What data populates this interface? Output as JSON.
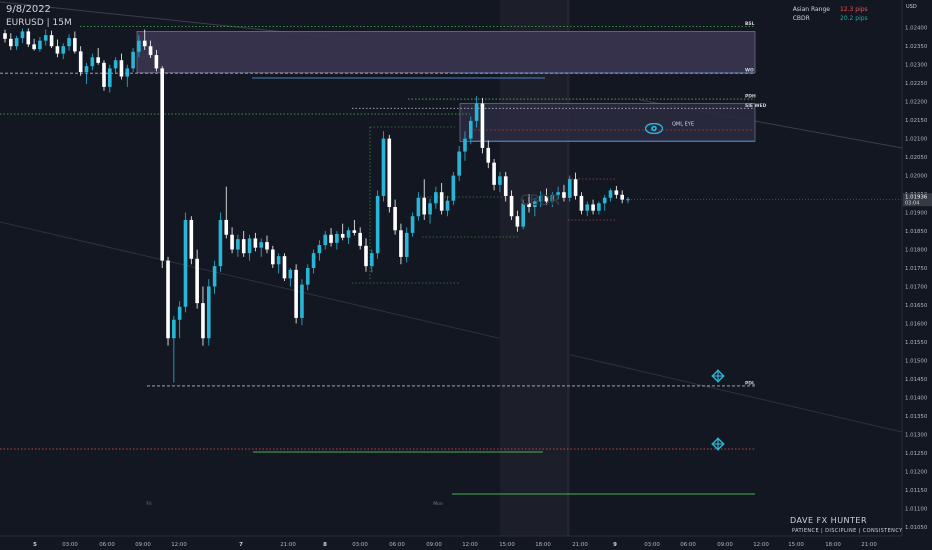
{
  "header": {
    "date": "9/8/2022",
    "symbol_timeframe": "EURUSD | 15M"
  },
  "session_stats": {
    "rows": [
      {
        "label": "Asian Range",
        "value": "12.3 pips",
        "color": "#ef5350"
      },
      {
        "label": "CBDR",
        "value": "20.2 pips",
        "color": "#26a69a"
      }
    ]
  },
  "branding": {
    "title": "DAVE FX HUNTER",
    "motto": "PATIENCE | DISCIPLINE | CONSISTENCY"
  },
  "chart_data": {
    "type": "candlestick",
    "symbol": "EURUSD",
    "timeframe": "15M",
    "currency_label": "USD",
    "y_ticks": [
      "1.02450",
      "1.02400",
      "1.02350",
      "1.02300",
      "1.02250",
      "1.02200",
      "1.02150",
      "1.02100",
      "1.02050",
      "1.02000",
      "1.01950",
      "1.01900",
      "1.01850",
      "1.01800",
      "1.01750",
      "1.01700",
      "1.01650",
      "1.01600",
      "1.01550",
      "1.01500",
      "1.01450",
      "1.01400",
      "1.01350",
      "1.01300",
      "1.01250",
      "1.01200",
      "1.01150",
      "1.01100",
      "1.01050"
    ],
    "ylim": [
      1.01025,
      1.02475
    ],
    "current_price": {
      "price": "1.01936",
      "countdown": "03:04"
    },
    "x_ticks": [
      "5",
      "03:00",
      "06:00",
      "09:00",
      "12:00",
      "7",
      "21:00",
      "8",
      "03:00",
      "06:00",
      "09:00",
      "12:00",
      "15:00",
      "18:00",
      "21:00",
      "9",
      "03:00",
      "06:00",
      "09:00",
      "12:00",
      "15:00",
      "18:00",
      "21:00"
    ],
    "session_labels": [
      "Fri",
      "Mon"
    ],
    "levels": [
      {
        "label": "BSL",
        "price": 1.02403,
        "color": "#4caf50",
        "style": "dotted"
      },
      {
        "label": "WO",
        "price": 1.02277,
        "color": "#b2b5be",
        "style": "dashed"
      },
      {
        "label": "PDH",
        "price": 1.02207,
        "color": "#4caf50",
        "style": "dotted"
      },
      {
        "label": "SIE WED",
        "price": 1.02182,
        "color": "#b2b5be",
        "style": "dotted"
      },
      {
        "label": "PDL",
        "price": 1.01431,
        "color": "#b2b5be",
        "style": "dashed"
      }
    ],
    "zones": [
      {
        "label": "",
        "top": 1.0239,
        "bottom": 1.02278,
        "color": "#3a3550"
      },
      {
        "label": "QML EYE",
        "top": 1.02195,
        "bottom": 1.02092,
        "color": "#2b2a40"
      }
    ],
    "candles_ohlc": [
      [
        1.02385,
        1.02395,
        1.0236,
        1.0237
      ],
      [
        1.0237,
        1.02385,
        1.0234,
        1.0235
      ],
      [
        1.0235,
        1.02378,
        1.0234,
        1.02372
      ],
      [
        1.02372,
        1.02398,
        1.02358,
        1.0239
      ],
      [
        1.0239,
        1.02398,
        1.02348,
        1.02355
      ],
      [
        1.02355,
        1.0237,
        1.02338,
        1.02342
      ],
      [
        1.02342,
        1.02375,
        1.02335,
        1.02365
      ],
      [
        1.02365,
        1.02395,
        1.02352,
        1.0238
      ],
      [
        1.0238,
        1.02392,
        1.02345,
        1.0235
      ],
      [
        1.0235,
        1.02368,
        1.0232,
        1.0233
      ],
      [
        1.0233,
        1.02358,
        1.02315,
        1.0235
      ],
      [
        1.0235,
        1.02382,
        1.02338,
        1.02372
      ],
      [
        1.02372,
        1.0239,
        1.0233,
        1.02336
      ],
      [
        1.02336,
        1.0235,
        1.0227,
        1.0228
      ],
      [
        1.0228,
        1.02305,
        1.02248,
        1.02296
      ],
      [
        1.02296,
        1.0233,
        1.02285,
        1.0232
      ],
      [
        1.0232,
        1.02345,
        1.023,
        1.02305
      ],
      [
        1.02305,
        1.02312,
        1.0223,
        1.0224
      ],
      [
        1.0224,
        1.023,
        1.02225,
        1.0229
      ],
      [
        1.0229,
        1.0232,
        1.02275,
        1.02312
      ],
      [
        1.02312,
        1.0233,
        1.0226,
        1.02268
      ],
      [
        1.02268,
        1.023,
        1.0224,
        1.0229
      ],
      [
        1.0229,
        1.02345,
        1.0228,
        1.02335
      ],
      [
        1.02335,
        1.0238,
        1.0232,
        1.02365
      ],
      [
        1.02365,
        1.02395,
        1.0234,
        1.0235
      ],
      [
        1.0235,
        1.02365,
        1.02318,
        1.02326
      ],
      [
        1.02326,
        1.0234,
        1.02282,
        1.0229
      ],
      [
        1.0229,
        1.02296,
        1.0175,
        1.0177
      ],
      [
        1.0177,
        1.0178,
        1.0154,
        1.0156
      ],
      [
        1.0156,
        1.0162,
        1.0144,
        1.0161
      ],
      [
        1.0161,
        1.0166,
        1.0156,
        1.01645
      ],
      [
        1.01645,
        1.019,
        1.0163,
        1.0188
      ],
      [
        1.0188,
        1.0189,
        1.0176,
        1.01775
      ],
      [
        1.01775,
        1.018,
        1.0164,
        1.01655
      ],
      [
        1.01655,
        1.017,
        1.0154,
        1.0156
      ],
      [
        1.0156,
        1.0172,
        1.0154,
        1.017
      ],
      [
        1.017,
        1.0177,
        1.0168,
        1.01755
      ],
      [
        1.01755,
        1.019,
        1.0174,
        1.0188
      ],
      [
        1.0188,
        1.0197,
        1.0183,
        1.0184
      ],
      [
        1.0184,
        1.0186,
        1.0179,
        1.018
      ],
      [
        1.018,
        1.0184,
        1.0178,
        1.01828
      ],
      [
        1.01828,
        1.0185,
        1.0178,
        1.0179
      ],
      [
        1.0179,
        1.0184,
        1.0177,
        1.0183
      ],
      [
        1.0183,
        1.01845,
        1.01795,
        1.01805
      ],
      [
        1.01805,
        1.0183,
        1.0178,
        1.0182
      ],
      [
        1.0182,
        1.01838,
        1.0179,
        1.018
      ],
      [
        1.018,
        1.0181,
        1.0175,
        1.0176
      ],
      [
        1.0176,
        1.0179,
        1.01735,
        1.01782
      ],
      [
        1.01782,
        1.0179,
        1.01715,
        1.01722
      ],
      [
        1.01722,
        1.0175,
        1.017,
        1.01745
      ],
      [
        1.01745,
        1.0176,
        1.016,
        1.01615
      ],
      [
        1.01615,
        1.0172,
        1.01595,
        1.01705
      ],
      [
        1.01705,
        1.0176,
        1.0169,
        1.0175
      ],
      [
        1.0175,
        1.018,
        1.01735,
        1.0179
      ],
      [
        1.0179,
        1.01825,
        1.0177,
        1.01812
      ],
      [
        1.01812,
        1.0185,
        1.018,
        1.0184
      ],
      [
        1.0184,
        1.01858,
        1.01808,
        1.01818
      ],
      [
        1.01818,
        1.0185,
        1.018,
        1.01842
      ],
      [
        1.01842,
        1.0187,
        1.01825,
        1.01832
      ],
      [
        1.01832,
        1.0186,
        1.01815,
        1.01852
      ],
      [
        1.01852,
        1.0188,
        1.01838,
        1.01845
      ],
      [
        1.01845,
        1.0186,
        1.018,
        1.0181
      ],
      [
        1.0181,
        1.0183,
        1.0174,
        1.01755
      ],
      [
        1.01755,
        1.018,
        1.01738,
        1.0179
      ],
      [
        1.0179,
        1.0196,
        1.01775,
        1.01945
      ],
      [
        1.01945,
        1.0212,
        1.0193,
        1.021
      ],
      [
        1.021,
        1.0211,
        1.019,
        1.01915
      ],
      [
        1.01915,
        1.01935,
        1.0184,
        1.01852
      ],
      [
        1.01852,
        1.0187,
        1.0176,
        1.0178
      ],
      [
        1.0178,
        1.0186,
        1.01765,
        1.01845
      ],
      [
        1.01845,
        1.019,
        1.01835,
        1.0189
      ],
      [
        1.0189,
        1.01955,
        1.01878,
        1.0194
      ],
      [
        1.0194,
        1.0199,
        1.0188,
        1.01895
      ],
      [
        1.01895,
        1.01938,
        1.0187,
        1.01925
      ],
      [
        1.01925,
        1.0197,
        1.0191,
        1.01955
      ],
      [
        1.01955,
        1.0198,
        1.01895,
        1.01905
      ],
      [
        1.01905,
        1.01945,
        1.0189,
        1.01932
      ],
      [
        1.01932,
        1.0201,
        1.0192,
        1.02
      ],
      [
        1.02,
        1.0208,
        1.01985,
        1.02065
      ],
      [
        1.02065,
        1.0212,
        1.0204,
        1.021
      ],
      [
        1.021,
        1.0216,
        1.02085,
        1.02148
      ],
      [
        1.02148,
        1.02215,
        1.0213,
        1.02195
      ],
      [
        1.02195,
        1.0221,
        1.0206,
        1.02075
      ],
      [
        1.02075,
        1.02095,
        1.0202,
        1.02035
      ],
      [
        1.02035,
        1.02045,
        1.0196,
        1.01975
      ],
      [
        1.01975,
        1.0201,
        1.01955,
        1.01998
      ],
      [
        1.01998,
        1.0201,
        1.0193,
        1.01945
      ],
      [
        1.01945,
        1.0196,
        1.0188,
        1.0189
      ],
      [
        1.0189,
        1.01905,
        1.01848,
        1.01862
      ],
      [
        1.01862,
        1.01935,
        1.01855,
        1.01925
      ],
      [
        1.01925,
        1.0195,
        1.019,
        1.01915
      ],
      [
        1.01915,
        1.0194,
        1.0189,
        1.0193
      ],
      [
        1.0193,
        1.01958,
        1.01915,
        1.01945
      ],
      [
        1.01945,
        1.01965,
        1.0192,
        1.0193
      ],
      [
        1.0193,
        1.01955,
        1.01915,
        1.01948
      ],
      [
        1.01948,
        1.0197,
        1.01935,
        1.01955
      ],
      [
        1.01955,
        1.01975,
        1.0193,
        1.0194
      ],
      [
        1.0194,
        1.02,
        1.0193,
        1.0199
      ],
      [
        1.0199,
        1.02008,
        1.01935,
        1.01945
      ],
      [
        1.01945,
        1.01955,
        1.01895,
        1.01905
      ],
      [
        1.01905,
        1.0193,
        1.0189,
        1.01922
      ],
      [
        1.01922,
        1.01935,
        1.01895,
        1.01905
      ],
      [
        1.01905,
        1.0193,
        1.01895,
        1.01925
      ],
      [
        1.01925,
        1.01948,
        1.01905,
        1.0194
      ],
      [
        1.0194,
        1.01965,
        1.0193,
        1.0196
      ],
      [
        1.0196,
        1.01972,
        1.01938,
        1.01948
      ],
      [
        1.01948,
        1.0196,
        1.01925,
        1.01935
      ],
      [
        1.01935,
        1.01942,
        1.01925,
        1.01936
      ]
    ]
  }
}
